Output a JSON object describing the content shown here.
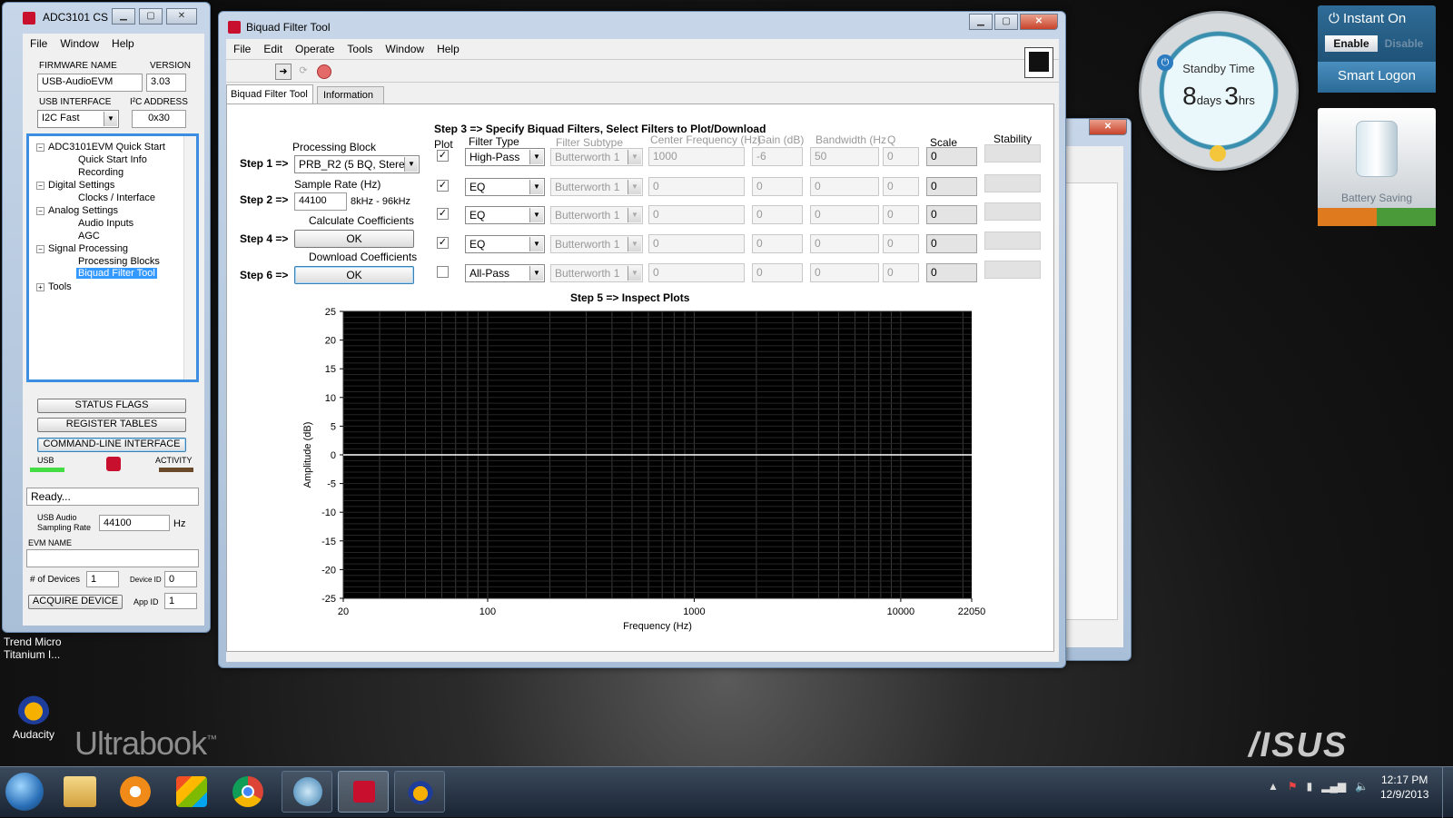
{
  "desktop": {
    "icons": [
      {
        "label_line1": "Trend Micro",
        "label_line2": "Titanium I..."
      },
      {
        "label_line1": "Audacity"
      }
    ],
    "ultrabook": "Ultrabook",
    "tm": "™",
    "asus": "/ISUS"
  },
  "gadgets": {
    "standby": {
      "title": "Standby Time",
      "days_num": "8",
      "days_unit": "days",
      "hrs_num": "3",
      "hrs_unit": "hrs"
    },
    "instant_on": {
      "title": "Instant On",
      "enable": "Enable",
      "disable": "Disable",
      "smart_logon": "Smart Logon"
    },
    "battery": {
      "label": "Battery Saving"
    }
  },
  "adc_window": {
    "title": "ADC3101 CS",
    "menu": [
      "File",
      "Window",
      "Help"
    ],
    "firmware_label": "FIRMWARE NAME",
    "firmware_value": "USB-AudioEVM",
    "version_label": "VERSION",
    "version_value": "3.03",
    "usb_interface_label": "USB INTERFACE",
    "usb_interface_value": "I2C Fast",
    "i2c_label": "I²C ADDRESS",
    "i2c_value": "0x30",
    "tree": [
      "ADC3101EVM Quick Start",
      "Quick Start Info",
      "Recording",
      "Digital Settings",
      "Clocks / Interface",
      "Analog Settings",
      "Audio Inputs",
      "AGC",
      "Signal Processing",
      "Processing Blocks",
      "Biquad Filter Tool",
      "Tools"
    ],
    "status_flags": "STATUS FLAGS",
    "register_tables": "REGISTER TABLES",
    "cli": "COMMAND-LINE INTERFACE",
    "usb_label": "USB",
    "activity_label": "ACTIVITY",
    "status_text": "Ready...",
    "usb_audio_line1": "USB Audio",
    "usb_audio_line2": "Sampling Rate",
    "sampling_rate": "44100",
    "hz": "Hz",
    "evm_name_label": "EVM NAME",
    "devices_label": "# of Devices",
    "devices_value": "1",
    "device_id_label": "Device ID",
    "device_id_value": "0",
    "acquire": "ACQUIRE DEVICE",
    "app_id_label": "App ID",
    "app_id_value": "1"
  },
  "biquad_window": {
    "title": "Biquad Filter Tool",
    "menu": [
      "File",
      "Edit",
      "Operate",
      "Tools",
      "Window",
      "Help"
    ],
    "tabs": [
      "Biquad Filter Tool",
      "Information"
    ],
    "step1": "Step 1 =>",
    "processing_block_label": "Processing Block",
    "processing_block_value": "PRB_R2 (5 BQ, Stereo)",
    "step2": "Step 2 =>",
    "sample_rate_label": "Sample Rate (Hz)",
    "sample_rate_value": "44100",
    "sample_rate_range": "8kHz - 96kHz",
    "calc_label": "Calculate Coefficients",
    "step4": "Step 4 =>",
    "ok": "OK",
    "download_label": "Download Coefficients",
    "step6": "Step 6 =>",
    "step3": "Step 3 => Specify  Biquad Filters, Select Filters to Plot/Download",
    "col_plot": "Plot",
    "col_filter_type": "Filter Type",
    "col_subtype": "Filter Subtype",
    "col_center": "Center Frequency (Hz)",
    "col_gain": "Gain (dB)",
    "col_bw": "Bandwidth (Hz",
    "col_q": "Q",
    "col_scale": "Scale",
    "col_stability": "Stability",
    "filters": [
      {
        "checked": "✓",
        "type": "High-Pass",
        "subtype": "Butterworth 1",
        "center": "1000",
        "gain": "-6",
        "bw": "50",
        "q": "0",
        "scale": "0"
      },
      {
        "checked": "✓",
        "type": "EQ",
        "subtype": "Butterworth 1",
        "center": "0",
        "gain": "0",
        "bw": "0",
        "q": "0",
        "scale": "0"
      },
      {
        "checked": "✓",
        "type": "EQ",
        "subtype": "Butterworth 1",
        "center": "0",
        "gain": "0",
        "bw": "0",
        "q": "0",
        "scale": "0"
      },
      {
        "checked": "✓",
        "type": "EQ",
        "subtype": "Butterworth 1",
        "center": "0",
        "gain": "0",
        "bw": "0",
        "q": "0",
        "scale": "0"
      },
      {
        "checked": "",
        "type": "All-Pass",
        "subtype": "Butterworth 1",
        "center": "0",
        "gain": "0",
        "bw": "0",
        "q": "0",
        "scale": "0"
      }
    ],
    "step5": "Step 5 => Inspect Plots"
  },
  "chart_data": {
    "type": "line",
    "title": "",
    "xlabel": "Frequency (Hz)",
    "ylabel": "Amplitude (dB)",
    "x_scale": "log",
    "xlim": [
      20,
      22050
    ],
    "ylim": [
      -25,
      25
    ],
    "x_ticks": [
      20,
      100,
      1000,
      10000,
      22050
    ],
    "x_tick_labels": [
      "20",
      "100",
      "1000",
      "10000",
      "22050"
    ],
    "y_ticks": [
      25,
      20,
      15,
      10,
      5,
      0,
      -5,
      -10,
      -15,
      -20,
      -25
    ],
    "y_tick_labels": [
      "25",
      "20",
      "15",
      "10",
      "5",
      "0",
      "-5",
      "-10",
      "-15",
      "-20",
      "-25"
    ],
    "grid": true,
    "background": "#000000",
    "series": [
      {
        "x": [
          20,
          22050
        ],
        "y": [
          0,
          0
        ],
        "color": "#ffffff"
      }
    ]
  },
  "taskbar": {
    "time": "12:17 PM",
    "date": "12/9/2013"
  }
}
